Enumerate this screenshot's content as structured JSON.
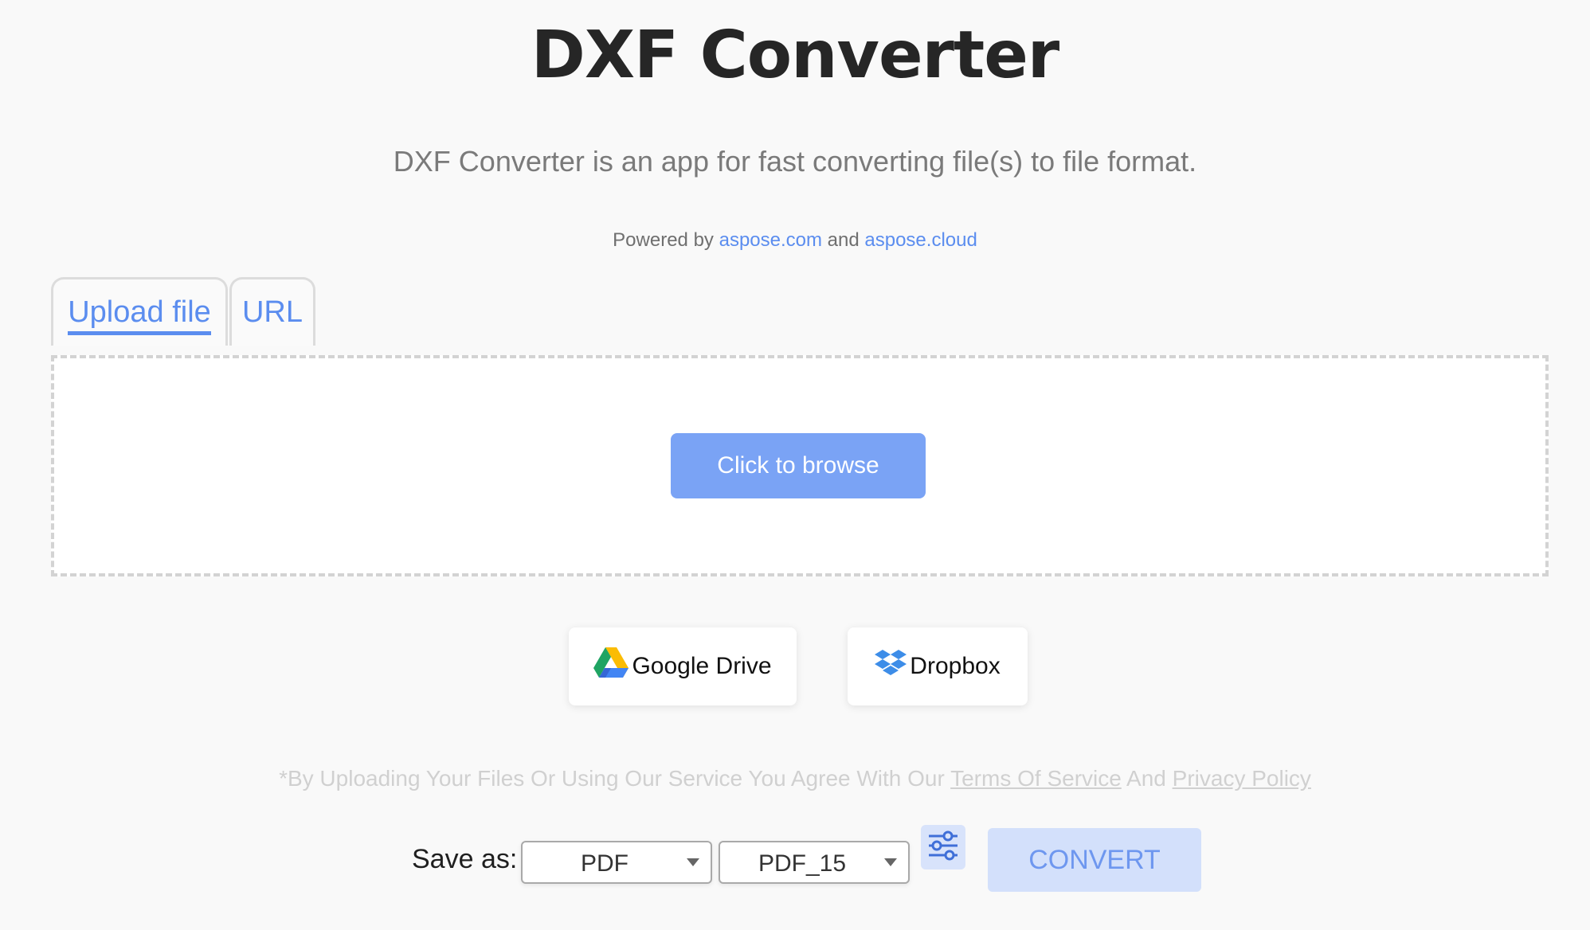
{
  "header": {
    "title": "DXF Converter",
    "subtitle": "DXF Converter is an app for fast converting file(s) to file format.",
    "powered_prefix": "Powered by",
    "powered_link1": "aspose.com",
    "powered_and": "and",
    "powered_link2": "aspose.cloud"
  },
  "tabs": [
    {
      "label": "Upload file",
      "active": true
    },
    {
      "label": "URL",
      "active": false
    }
  ],
  "upload": {
    "browse_label": "Click to browse"
  },
  "cloud": {
    "google_drive_label": "Google Drive",
    "dropbox_label": "Dropbox"
  },
  "terms": {
    "prefix": "*By Uploading Your Files Or Using Our Service You Agree With Our",
    "terms_link": "Terms Of Service",
    "and": "And",
    "privacy_link": "Privacy Policy"
  },
  "save": {
    "label": "Save as:",
    "format_value": "PDF",
    "version_value": "PDF_15",
    "convert_label": "CONVERT"
  },
  "colors": {
    "accent": "#5b8def",
    "browse_bg": "#7aa3f5",
    "convert_bg": "#d3e0fb",
    "page_bg": "#f9f9f9"
  },
  "icons": {
    "google_drive": "google-drive-icon",
    "dropbox": "dropbox-icon",
    "settings": "sliders-icon",
    "caret": "chevron-down-icon"
  }
}
